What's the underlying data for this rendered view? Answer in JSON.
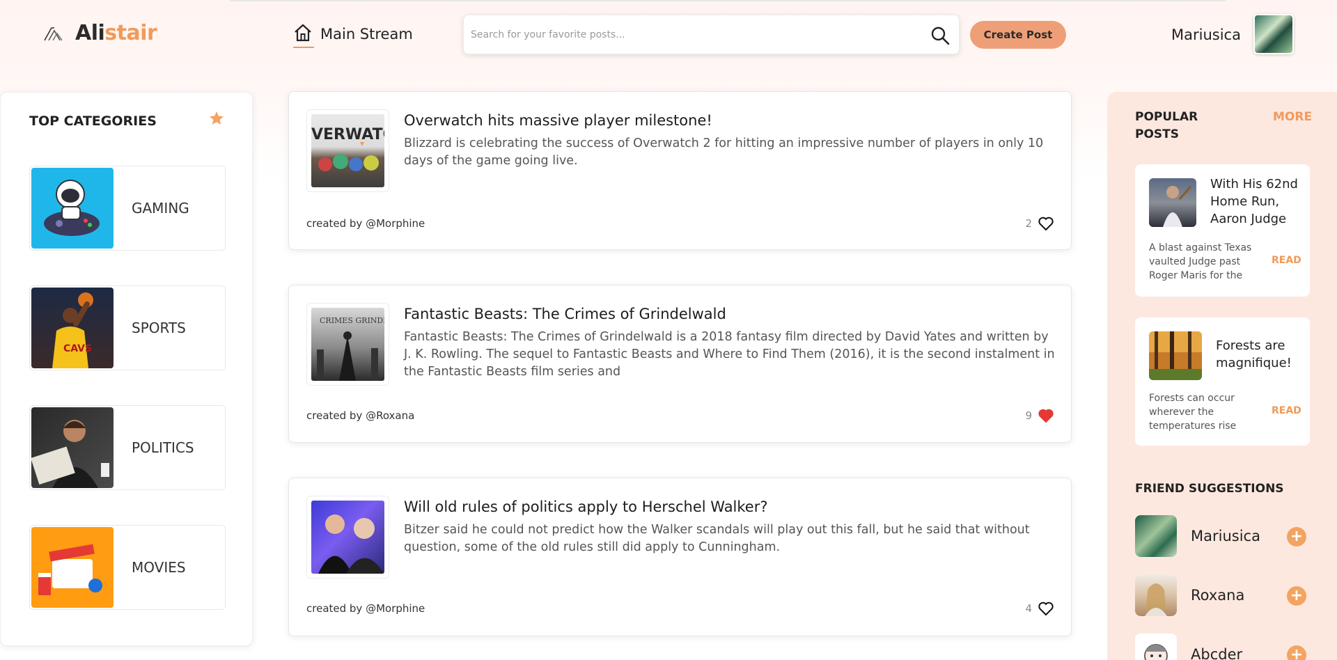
{
  "brand": {
    "part1": "Ali",
    "part2": "stair"
  },
  "nav": {
    "main_stream": "Main Stream"
  },
  "search": {
    "placeholder": "Search for your favorite posts..."
  },
  "header": {
    "create_post": "Create Post",
    "username": "Mariusica"
  },
  "categories": {
    "title": "TOP CATEGORIES",
    "items": [
      {
        "label": "GAMING"
      },
      {
        "label": "SPORTS"
      },
      {
        "label": "POLITICS"
      },
      {
        "label": "MOVIES"
      }
    ]
  },
  "posts": [
    {
      "title": "Overwatch hits massive player milestone!",
      "body": "Blizzard is celebrating the success of Overwatch 2 for hitting an impressive number of players in only 10 days of the game going live.",
      "thumb_text": "VERWATC",
      "author": "created by @Morphine",
      "likes": "2",
      "liked": false
    },
    {
      "title": "Fantastic Beasts: The Crimes of Grindelwald",
      "body": "Fantastic Beasts: The Crimes of Grindelwald is a 2018 fantasy film directed by David Yates and written by J. K. Rowling. The sequel to Fantastic Beasts and Where to Find Them (2016), it is the second instalment in the Fantastic Beasts film series and",
      "thumb_text": "CRIMES GRINDELWALD",
      "author": "created by @Roxana",
      "likes": "9",
      "liked": true
    },
    {
      "title": "Will old rules of politics apply to Herschel Walker?",
      "body": "Bitzer said he could not predict how the Walker scandals will play out this fall, but he said that without question, some of the old rules still did apply to Cunningham.",
      "author": "created by @Morphine",
      "likes": "4",
      "liked": false
    }
  ],
  "popular": {
    "title": "POPULAR POSTS",
    "more": "MORE",
    "items": [
      {
        "title": "With His 62nd Home Run, Aaron Judge",
        "excerpt": "A blast against Texas vaulted Judge past Roger Maris for the",
        "read": "READ"
      },
      {
        "title": "Forests are magnifique!",
        "excerpt": "Forests can occur wherever the temperatures rise",
        "read": "READ"
      }
    ]
  },
  "friends": {
    "title": "FRIEND SUGGESTIONS",
    "items": [
      {
        "name": "Mariusica",
        "add": "+"
      },
      {
        "name": "Roxana",
        "add": "+"
      },
      {
        "name": "Abcder",
        "add": "+"
      }
    ]
  },
  "colors": {
    "accent": "#f19a5a",
    "button": "#ee9f77",
    "panel": "#fde8e0",
    "heart_liked": "#e53935"
  }
}
